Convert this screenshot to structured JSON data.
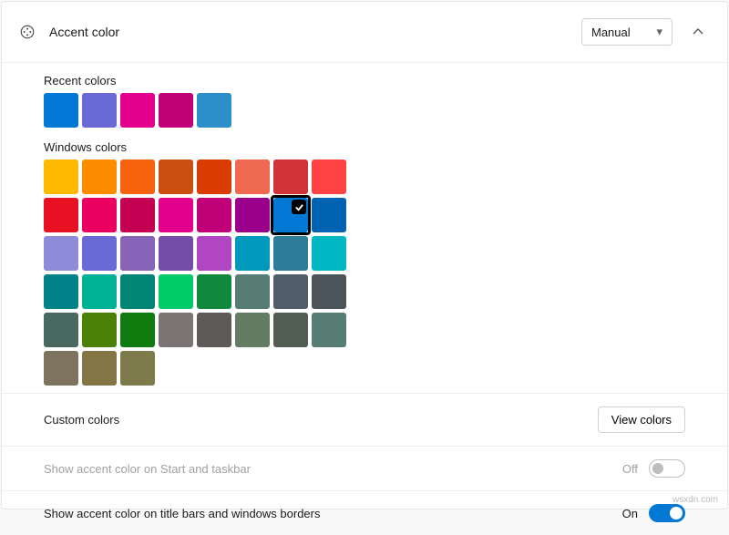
{
  "header": {
    "title": "Accent color",
    "mode_label": "Manual"
  },
  "recent": {
    "label": "Recent colors",
    "colors": [
      "#0078d4",
      "#6b69d6",
      "#e3008c",
      "#bf0077",
      "#2d8fca"
    ]
  },
  "windows_colors": {
    "label": "Windows colors",
    "selected_index": 14,
    "colors": [
      "#ffb900",
      "#ff8c00",
      "#f7630c",
      "#ca5010",
      "#da3b01",
      "#ef6950",
      "#d13438",
      "#ff4343",
      "#e81123",
      "#ea005e",
      "#c30052",
      "#e3008c",
      "#bf0077",
      "#9a0089",
      "#0078d4",
      "#0063b1",
      "#8e8cd8",
      "#6b69d6",
      "#8764b8",
      "#744da9",
      "#b146c2",
      "#0099bc",
      "#2d7d9a",
      "#00b7c3",
      "#038387",
      "#00b294",
      "#018574",
      "#00cc6a",
      "#10893e",
      "#567c73",
      "#515c6b",
      "#4a5459",
      "#486860",
      "#498205",
      "#107c10",
      "#7a7574",
      "#5d5a58",
      "#647c64",
      "#525e54",
      "#567c73",
      "#7e735f",
      "#847545",
      "#7e7a4b"
    ]
  },
  "rows": {
    "custom_label": "Custom colors",
    "view_colors_btn": "View colors",
    "start_taskbar_label": "Show accent color on Start and taskbar",
    "start_taskbar_status": "Off",
    "titlebar_label": "Show accent color on title bars and windows borders",
    "titlebar_status": "On"
  },
  "watermark": "wsxdn.com"
}
